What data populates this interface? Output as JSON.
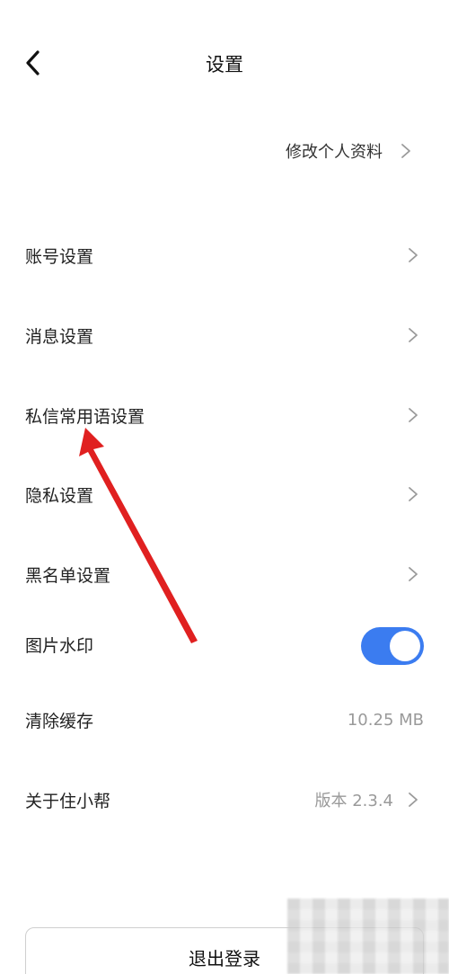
{
  "header": {
    "title": "设置",
    "back_icon": "chevron-left-icon"
  },
  "profile_link": {
    "label": "修改个人资料",
    "icon": "chevron-right-icon"
  },
  "settings": [
    {
      "label": "账号设置",
      "icon": "chevron-right-icon"
    },
    {
      "label": "消息设置",
      "icon": "chevron-right-icon"
    },
    {
      "label": "私信常用语设置",
      "icon": "chevron-right-icon"
    },
    {
      "label": "隐私设置",
      "icon": "chevron-right-icon"
    },
    {
      "label": "黑名单设置",
      "icon": "chevron-right-icon"
    }
  ],
  "watermark_toggle": {
    "label": "图片水印",
    "on": true,
    "color": "#3b7cf0"
  },
  "clear_cache": {
    "label": "清除缓存",
    "value": "10.25 MB"
  },
  "about": {
    "label": "关于住小帮",
    "value": "版本 2.3.4",
    "icon": "chevron-right-icon"
  },
  "logout": {
    "label": "退出登录"
  },
  "colors": {
    "accent": "#3b7cf0",
    "annotation_arrow": "#e02020"
  }
}
